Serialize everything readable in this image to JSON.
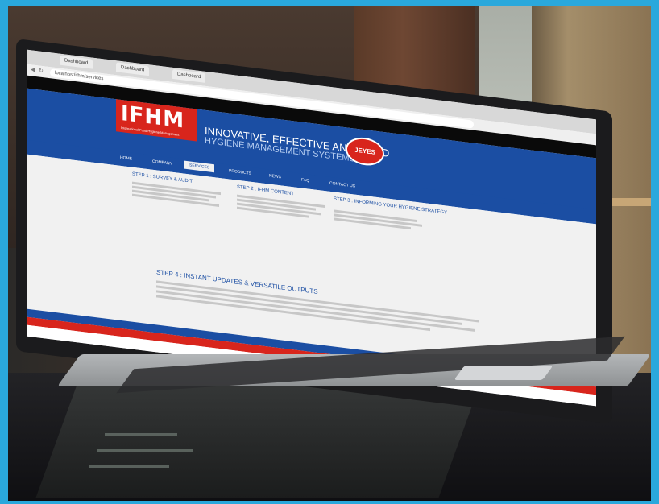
{
  "browser": {
    "tabs": [
      "Dashboard",
      "Dashboard",
      "Dashboard"
    ],
    "url": "localhost/ifhm/services"
  },
  "site": {
    "logo": "IFHM",
    "tagline": "International Food Hygiene Management",
    "hero_line1": "INNOVATIVE, EFFECTIVE AND RAPID",
    "hero_line2": "HYGIENE MANAGEMENT SYSTEMS",
    "partner_badge": "JEYES",
    "nav": [
      "HOME",
      "COMPANY",
      "SERVICES",
      "PRODUCTS",
      "NEWS",
      "FAQ",
      "CONTACT US"
    ],
    "active_nav": "SERVICES",
    "steps": [
      {
        "title": "STEP 1 : SURVEY & AUDIT"
      },
      {
        "title": "STEP 2 : IFHM CONTENT"
      },
      {
        "title": "STEP 3 : INFORMING YOUR HYGIENE STRATEGY"
      }
    ],
    "step4_title": "STEP 4 : INSTANT UPDATES & VERSATILE OUTPUTS"
  },
  "colors": {
    "frame": "#2aa8dc",
    "brand_blue": "#1b4ea3",
    "brand_red": "#d8251c"
  }
}
